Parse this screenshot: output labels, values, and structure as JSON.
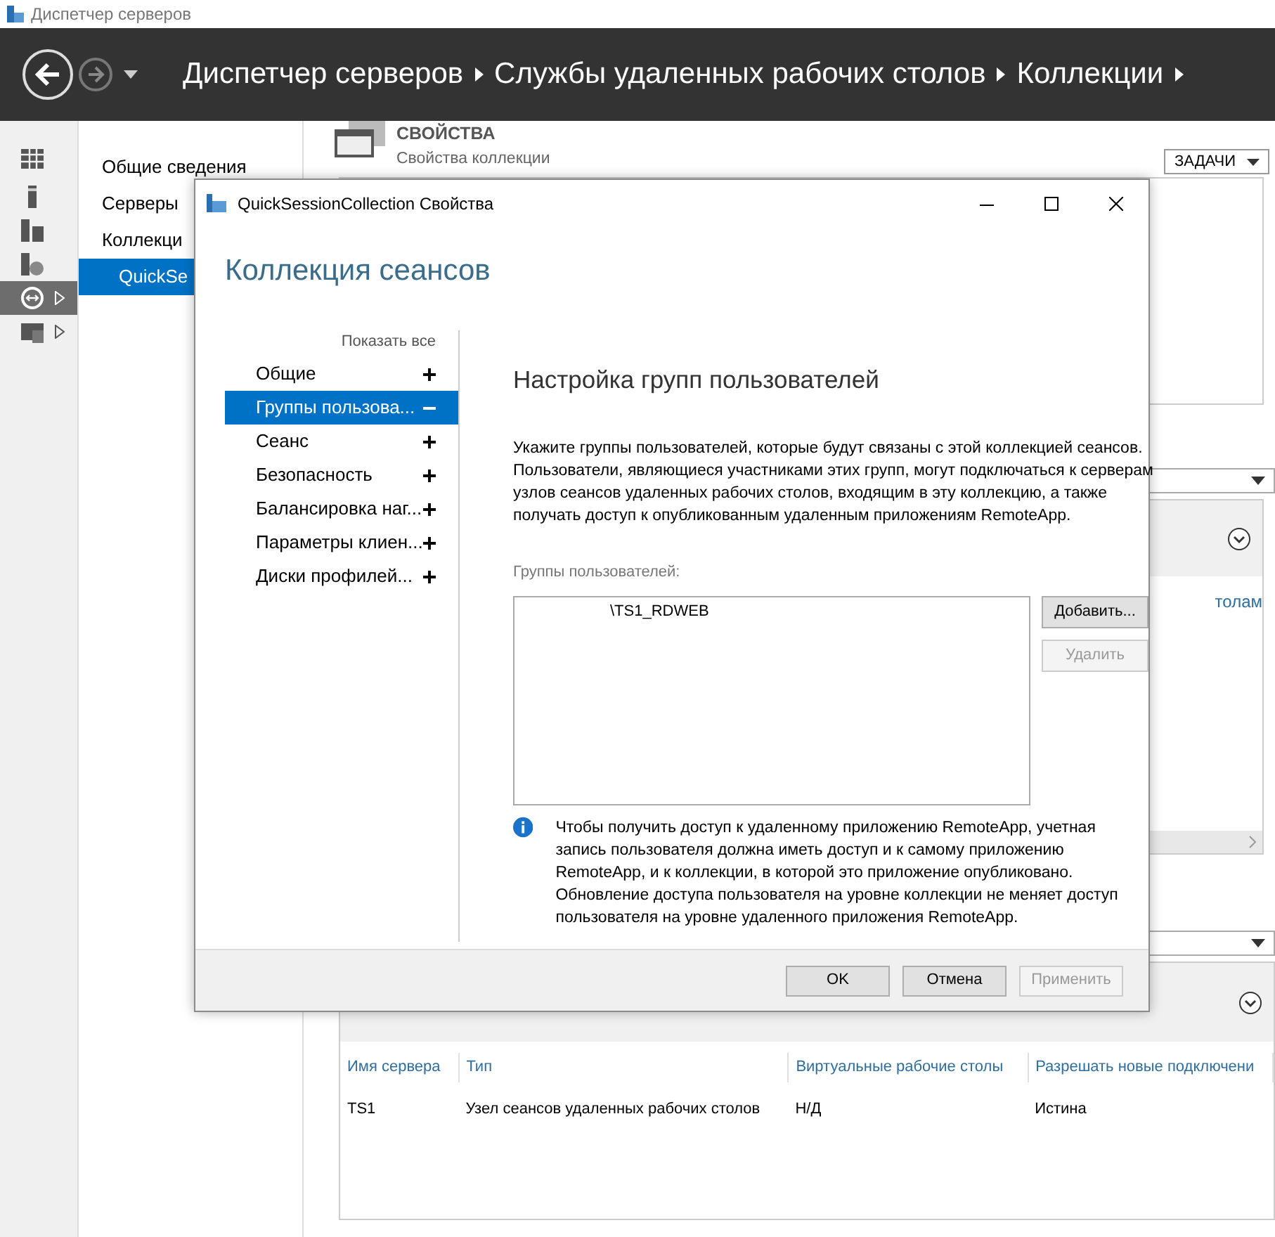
{
  "app_window": {
    "title": "Диспетчер серверов"
  },
  "header": {
    "breadcrumb": [
      "Диспетчер серверов",
      "Службы удаленных рабочих столов",
      "Коллекции"
    ]
  },
  "icon_bar": [
    {
      "kind": "dashboard",
      "selected": false,
      "expandable": false
    },
    {
      "kind": "server",
      "selected": false,
      "expandable": false
    },
    {
      "kind": "servers",
      "selected": false,
      "expandable": false
    },
    {
      "kind": "file-server",
      "selected": false,
      "expandable": false
    },
    {
      "kind": "remote",
      "selected": true,
      "expandable": true
    },
    {
      "kind": "storage",
      "selected": false,
      "expandable": true
    }
  ],
  "sidebar": {
    "items": [
      {
        "label": "Общие сведения",
        "selected": false
      },
      {
        "label": "Серверы",
        "selected": false
      },
      {
        "label": "Коллекци",
        "selected": false,
        "children": [
          {
            "label": "QuickSe",
            "selected": true
          }
        ]
      }
    ]
  },
  "properties": {
    "title": "СВОЙСТВА",
    "subtitle": "Свойства коллекции",
    "tasks_button": "ЗАДАЧИ"
  },
  "panel_link_fragment": "толам",
  "servers_table": {
    "columns": [
      "Имя сервера",
      "Тип",
      "Виртуальные рабочие столы",
      "Разрешать новые подключени"
    ],
    "rows": [
      [
        "TS1",
        "Узел сеансов удаленных рабочих столов",
        "Н/Д",
        "Истина"
      ]
    ]
  },
  "dialog": {
    "title": "QuickSessionCollection Свойства",
    "heading": "Коллекция сеансов",
    "show_all": "Показать все",
    "nav": [
      {
        "label": "Общие",
        "selected": false,
        "expanded": false
      },
      {
        "label": "Группы пользова...",
        "selected": true,
        "expanded": true
      },
      {
        "label": "Сеанс",
        "selected": false,
        "expanded": false
      },
      {
        "label": "Безопасность",
        "selected": false,
        "expanded": false
      },
      {
        "label": "Балансировка наг...",
        "selected": false,
        "expanded": false
      },
      {
        "label": "Параметры клиен...",
        "selected": false,
        "expanded": false
      },
      {
        "label": "Диски профилей...",
        "selected": false,
        "expanded": false
      }
    ],
    "section_title": "Настройка групп пользователей",
    "description": "Укажите группы пользователей, которые будут связаны с этой коллекцией сеансов. Пользователи, являющиеся участниками этих групп, могут подключаться к серверам узлов сеансов удаленных рабочих столов, входящим в эту коллекцию, а также получать доступ к опубликованным удаленным приложениям RemoteApp.",
    "groups_label": "Группы пользователей:",
    "groups": [
      {
        "name": "\\TS1_RDWEB",
        "selected": false
      }
    ],
    "side_buttons": [
      {
        "label": "Добавить...",
        "disabled": false
      },
      {
        "label": "Удалить",
        "disabled": true
      }
    ],
    "info_note": "Чтобы получить доступ к удаленному приложению RemoteApp, учетная запись пользователя должна иметь доступ и к самому приложению RemoteApp, и к коллекции, в которой это приложение опубликовано. Обновление доступа пользователя на уровне коллекции не меняет доступ пользователя на уровне удаленного приложения RemoteApp.",
    "footer_buttons": [
      {
        "label": "OK",
        "disabled": false
      },
      {
        "label": "Отмена",
        "disabled": false
      },
      {
        "label": "Применить",
        "disabled": true
      }
    ]
  }
}
